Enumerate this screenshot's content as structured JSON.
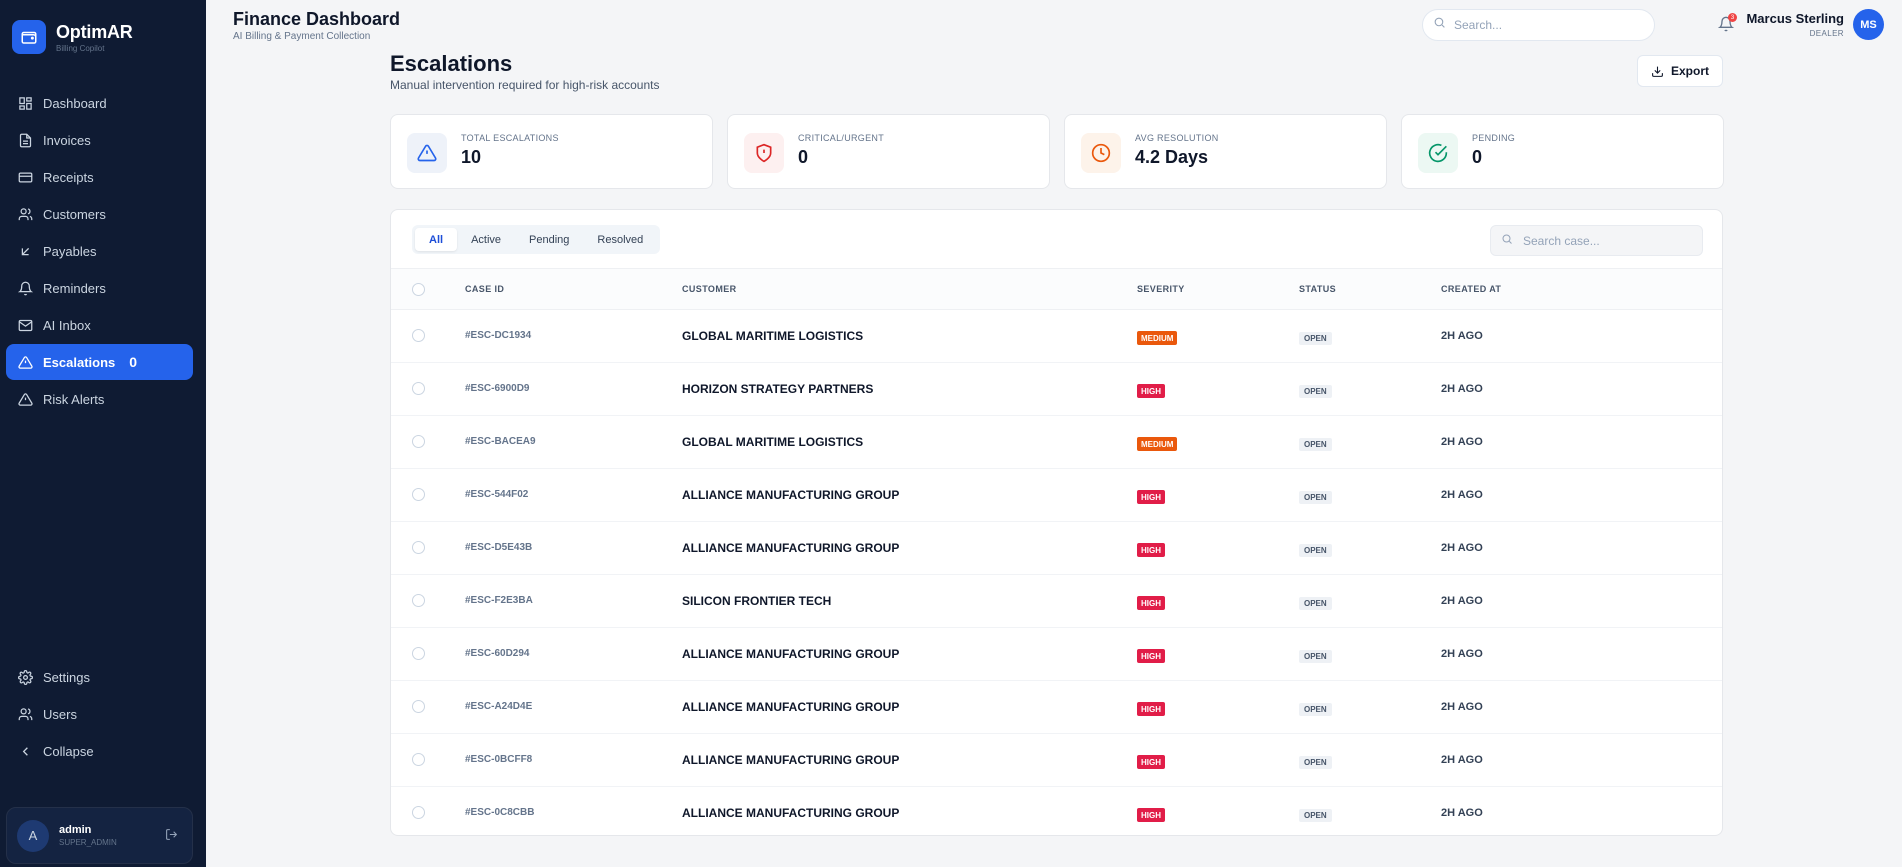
{
  "brand": {
    "name": "OptimAR",
    "subtitle": "Billing Copilot"
  },
  "sidebar": {
    "items": [
      {
        "label": "Dashboard",
        "icon": "dashboard-icon"
      },
      {
        "label": "Invoices",
        "icon": "file-text-icon"
      },
      {
        "label": "Receipts",
        "icon": "credit-card-icon"
      },
      {
        "label": "Customers",
        "icon": "users-icon"
      },
      {
        "label": "Payables",
        "icon": "arrow-down-left-icon"
      },
      {
        "label": "Reminders",
        "icon": "bell-icon"
      },
      {
        "label": "AI Inbox",
        "icon": "mail-icon"
      },
      {
        "label": "Escalations",
        "icon": "alert-triangle-icon",
        "count": "0",
        "active": true
      },
      {
        "label": "Risk Alerts",
        "icon": "alert-triangle-icon"
      }
    ],
    "bottom": [
      {
        "label": "Settings",
        "icon": "gear-icon"
      },
      {
        "label": "Users",
        "icon": "users-icon"
      },
      {
        "label": "Collapse",
        "icon": "chevron-left-icon"
      }
    ],
    "user": {
      "initial": "A",
      "name": "admin",
      "role": "SUPER_ADMIN"
    }
  },
  "header": {
    "title": "Finance Dashboard",
    "subtitle": "AI Billing & Payment Collection",
    "search_placeholder": "Search...",
    "notification_count": "3",
    "user_name": "Marcus Sterling",
    "user_role": "DEALER",
    "user_initials": "MS"
  },
  "page": {
    "title": "Escalations",
    "subtitle": "Manual intervention required for high-risk accounts",
    "export_label": "Export"
  },
  "stats": [
    {
      "label": "TOTAL ESCALATIONS",
      "value": "10",
      "icon": "alert-triangle-icon",
      "color": "#2563eb",
      "bg": "#eef2f9"
    },
    {
      "label": "CRITICAL/URGENT",
      "value": "0",
      "icon": "shield-alert-icon",
      "color": "#dc2626",
      "bg": "#fdf0f0"
    },
    {
      "label": "AVG RESOLUTION",
      "value": "4.2 Days",
      "icon": "clock-icon",
      "color": "#ea580c",
      "bg": "#fdf3ea"
    },
    {
      "label": "PENDING",
      "value": "0",
      "icon": "check-circle-icon",
      "color": "#059669",
      "bg": "#ecf8f3"
    }
  ],
  "table": {
    "tabs": [
      "All",
      "Active",
      "Pending",
      "Resolved"
    ],
    "active_tab": "All",
    "search_placeholder": "Search case...",
    "columns": [
      "CASE ID",
      "CUSTOMER",
      "SEVERITY",
      "STATUS",
      "CREATED AT"
    ],
    "rows": [
      {
        "id": "#ESC-DC1934",
        "customer": "GLOBAL MARITIME LOGISTICS",
        "severity": "MEDIUM",
        "status": "OPEN",
        "created": "2H AGO"
      },
      {
        "id": "#ESC-6900D9",
        "customer": "HORIZON STRATEGY PARTNERS",
        "severity": "HIGH",
        "status": "OPEN",
        "created": "2H AGO"
      },
      {
        "id": "#ESC-BACEA9",
        "customer": "GLOBAL MARITIME LOGISTICS",
        "severity": "MEDIUM",
        "status": "OPEN",
        "created": "2H AGO"
      },
      {
        "id": "#ESC-544F02",
        "customer": "ALLIANCE MANUFACTURING GROUP",
        "severity": "HIGH",
        "status": "OPEN",
        "created": "2H AGO"
      },
      {
        "id": "#ESC-D5E43B",
        "customer": "ALLIANCE MANUFACTURING GROUP",
        "severity": "HIGH",
        "status": "OPEN",
        "created": "2H AGO"
      },
      {
        "id": "#ESC-F2E3BA",
        "customer": "SILICON FRONTIER TECH",
        "severity": "HIGH",
        "status": "OPEN",
        "created": "2H AGO"
      },
      {
        "id": "#ESC-60D294",
        "customer": "ALLIANCE MANUFACTURING GROUP",
        "severity": "HIGH",
        "status": "OPEN",
        "created": "2H AGO"
      },
      {
        "id": "#ESC-A24D4E",
        "customer": "ALLIANCE MANUFACTURING GROUP",
        "severity": "HIGH",
        "status": "OPEN",
        "created": "2H AGO"
      },
      {
        "id": "#ESC-0BCFF8",
        "customer": "ALLIANCE MANUFACTURING GROUP",
        "severity": "HIGH",
        "status": "OPEN",
        "created": "2H AGO"
      },
      {
        "id": "#ESC-0C8CBB",
        "customer": "ALLIANCE MANUFACTURING GROUP",
        "severity": "HIGH",
        "status": "OPEN",
        "created": "2H AGO"
      }
    ]
  },
  "colors": {
    "accent": "#2563eb",
    "sidebar_bg": "#0f1b33",
    "severity_high": "#e11d48",
    "severity_medium": "#ea580c"
  }
}
